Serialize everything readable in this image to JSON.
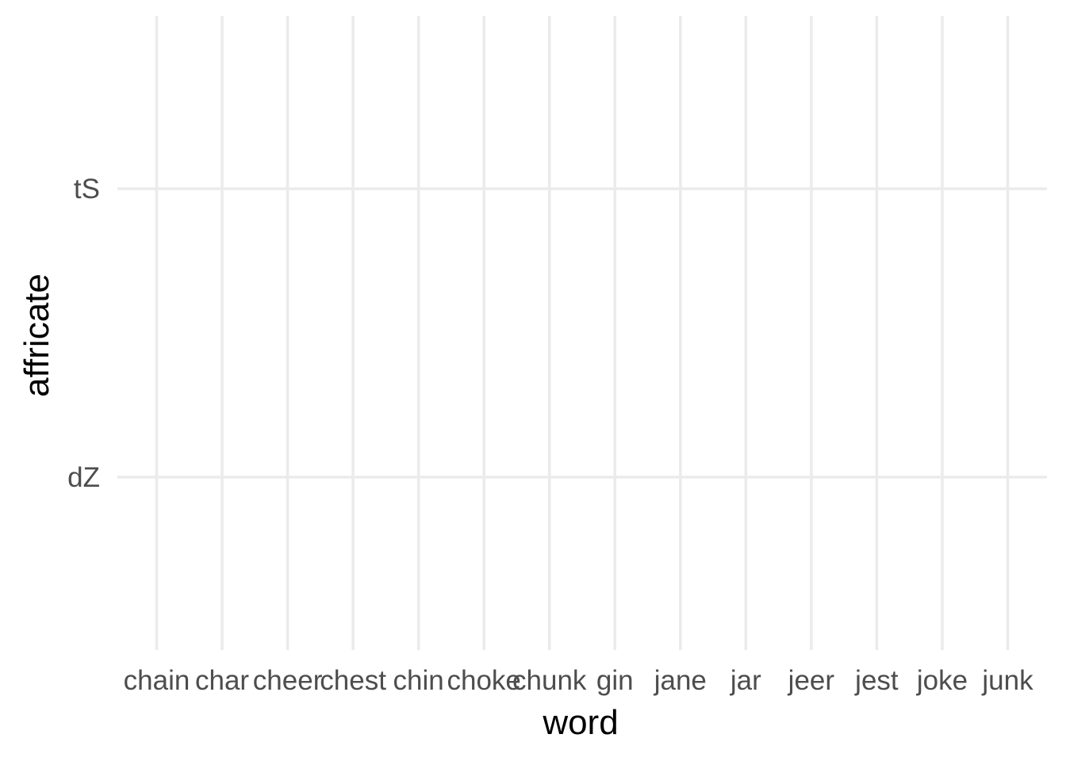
{
  "chart_data": {
    "type": "scatter",
    "title": "",
    "xlabel": "word",
    "ylabel": "affricate",
    "x_categories": [
      "chain",
      "char",
      "cheer",
      "chest",
      "chin",
      "choke",
      "chunk",
      "gin",
      "jane",
      "jar",
      "jeer",
      "jest",
      "joke",
      "junk"
    ],
    "y_categories": [
      "dZ",
      "tS"
    ],
    "points": [],
    "grid": true,
    "legend": "none"
  },
  "colors": {
    "grid": "#ebebeb",
    "tick_text": "#4d4d4d",
    "axis_title": "#000000",
    "background": "#ffffff"
  }
}
